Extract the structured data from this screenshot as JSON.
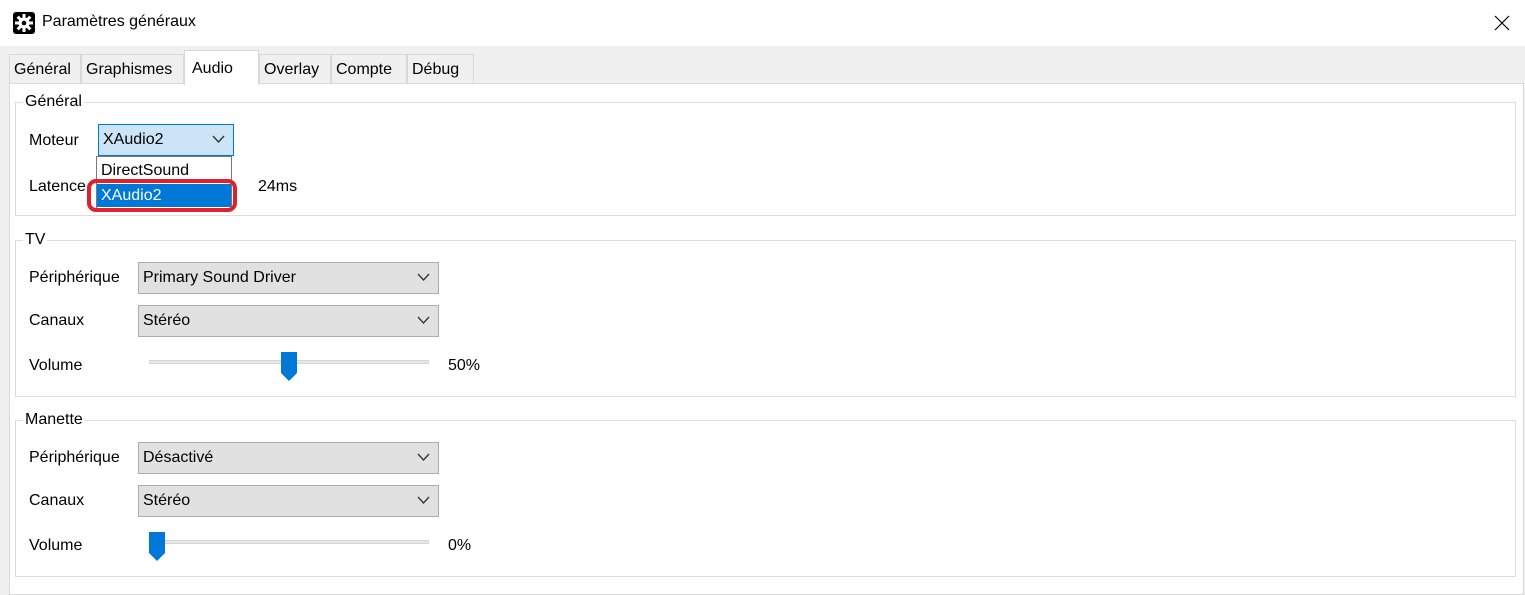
{
  "window": {
    "title": "Paramètres généraux",
    "icon": "gear-icon",
    "close_icon": "close-icon"
  },
  "tabs": [
    {
      "label": "Général",
      "active": false
    },
    {
      "label": "Graphismes",
      "active": false
    },
    {
      "label": "Audio",
      "active": true
    },
    {
      "label": "Overlay",
      "active": false
    },
    {
      "label": "Compte",
      "active": false
    },
    {
      "label": "Débug",
      "active": false
    }
  ],
  "general": {
    "group_label": "Général",
    "engine_label": "Moteur",
    "engine_value": "XAudio2",
    "latency_label": "Latence",
    "latency_value": "24ms",
    "engine_options": [
      "DirectSound",
      "XAudio2"
    ],
    "engine_selected_option": "XAudio2"
  },
  "tv": {
    "group_label": "TV",
    "device_label": "Périphérique",
    "device_value": "Primary Sound Driver",
    "channels_label": "Canaux",
    "channels_value": "Stéréo",
    "volume_label": "Volume",
    "volume_percent": 50,
    "volume_text": "50%"
  },
  "controller": {
    "group_label": "Manette",
    "device_label": "Périphérique",
    "device_value": "Désactivé",
    "channels_label": "Canaux",
    "channels_value": "Stéréo",
    "volume_label": "Volume",
    "volume_percent": 0,
    "volume_text": "0%"
  },
  "colors": {
    "accent": "#0078d7",
    "annotation": "#e0202a"
  }
}
